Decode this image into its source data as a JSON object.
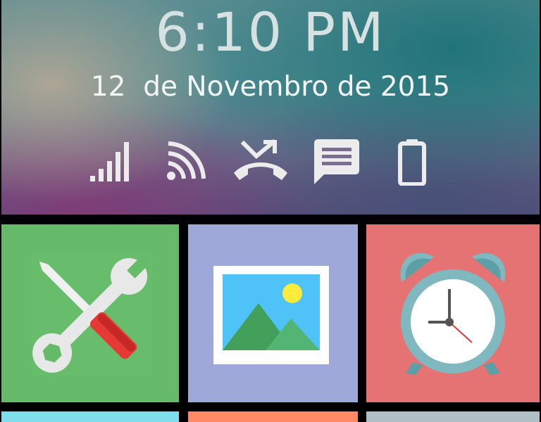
{
  "lockscreen": {
    "time": "6:10 PM",
    "date": "12  de Novembro de 2015"
  },
  "status_icons": [
    {
      "icon": "signal-strength-icon"
    },
    {
      "icon": "wifi-icon"
    },
    {
      "icon": "missed-call-icon"
    },
    {
      "icon": "message-icon"
    },
    {
      "icon": "battery-icon"
    }
  ],
  "tiles": [
    {
      "icon": "tools-icon",
      "color": "#65bb6a"
    },
    {
      "icon": "gallery-icon",
      "color": "#9ea8d9"
    },
    {
      "icon": "alarm-clock-icon",
      "color": "#e57373"
    },
    {
      "color": "#80deea"
    },
    {
      "color": "#ff8a65"
    },
    {
      "color": "#b0bec5"
    }
  ],
  "colors": {
    "background": "#000000",
    "clock_text": "#d6e2e2",
    "status_icon": "#ececec"
  }
}
